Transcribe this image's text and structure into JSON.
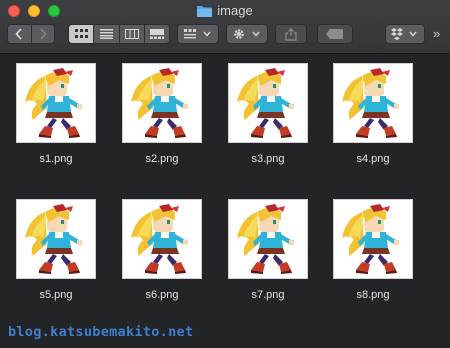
{
  "window": {
    "title": "image",
    "folder_icon": "folder-icon",
    "colors": {
      "folder": "#5aa6e8",
      "accent_watermark": "#3f7fd0"
    }
  },
  "toolbar": {
    "back_icon": "chevron-left-icon",
    "forward_icon": "chevron-right-icon",
    "view_modes": [
      "icon-view-icon",
      "list-view-icon",
      "column-view-icon",
      "gallery-view-icon"
    ],
    "arrange_icon": "arrange-icon",
    "action_icon": "gear-icon",
    "share_icon": "share-icon",
    "tag_icon": "tag-icon",
    "dropbox_icon": "dropbox-icon",
    "more_label": "»"
  },
  "files": [
    {
      "name": "s1.png"
    },
    {
      "name": "s2.png"
    },
    {
      "name": "s3.png"
    },
    {
      "name": "s4.png"
    },
    {
      "name": "s5.png"
    },
    {
      "name": "s6.png"
    },
    {
      "name": "s7.png"
    },
    {
      "name": "s8.png"
    }
  ],
  "watermark": "blog.katsubemakito.net"
}
